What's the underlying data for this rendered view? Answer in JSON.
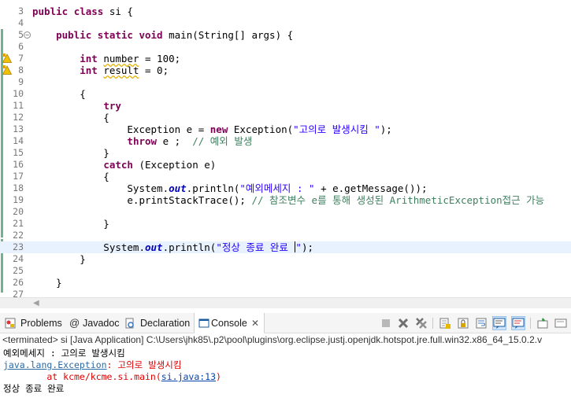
{
  "editor": {
    "lines": [
      {
        "n": "3",
        "tokens": [
          {
            "t": "public",
            "c": "kw"
          },
          {
            "t": " "
          },
          {
            "t": "class",
            "c": "kw"
          },
          {
            "t": " si {"
          }
        ]
      },
      {
        "n": "4",
        "tokens": []
      },
      {
        "n": "5",
        "tokens": [
          {
            "t": "    "
          },
          {
            "t": "public",
            "c": "kw"
          },
          {
            "t": " "
          },
          {
            "t": "static",
            "c": "kw"
          },
          {
            "t": " "
          },
          {
            "t": "void",
            "c": "kw"
          },
          {
            "t": " main(String[] args) {"
          }
        ]
      },
      {
        "n": "6",
        "tokens": []
      },
      {
        "n": "7",
        "tokens": [
          {
            "t": "        "
          },
          {
            "t": "int",
            "c": "kw"
          },
          {
            "t": " "
          },
          {
            "t": "number",
            "c": "warn-var"
          },
          {
            "t": " = 100;"
          }
        ]
      },
      {
        "n": "8",
        "tokens": [
          {
            "t": "        "
          },
          {
            "t": "int",
            "c": "kw"
          },
          {
            "t": " "
          },
          {
            "t": "result",
            "c": "warn-var"
          },
          {
            "t": " = 0;"
          }
        ]
      },
      {
        "n": "9",
        "tokens": []
      },
      {
        "n": "10",
        "tokens": [
          {
            "t": "        {"
          }
        ]
      },
      {
        "n": "11",
        "tokens": [
          {
            "t": "            "
          },
          {
            "t": "try",
            "c": "kw"
          }
        ]
      },
      {
        "n": "12",
        "tokens": [
          {
            "t": "            {"
          }
        ]
      },
      {
        "n": "13",
        "tokens": [
          {
            "t": "                Exception e = "
          },
          {
            "t": "new",
            "c": "kw"
          },
          {
            "t": " Exception("
          },
          {
            "t": "\"고의로 발생시킴 \"",
            "c": "str"
          },
          {
            "t": ");"
          }
        ]
      },
      {
        "n": "14",
        "tokens": [
          {
            "t": "                "
          },
          {
            "t": "throw",
            "c": "kw"
          },
          {
            "t": " e ;  "
          },
          {
            "t": "// 예외 발생",
            "c": "cmt"
          }
        ]
      },
      {
        "n": "15",
        "tokens": [
          {
            "t": "            }"
          }
        ]
      },
      {
        "n": "16",
        "tokens": [
          {
            "t": "            "
          },
          {
            "t": "catch",
            "c": "kw"
          },
          {
            "t": " (Exception e)"
          }
        ]
      },
      {
        "n": "17",
        "tokens": [
          {
            "t": "            {"
          }
        ]
      },
      {
        "n": "18",
        "tokens": [
          {
            "t": "                System."
          },
          {
            "t": "out",
            "c": "ital"
          },
          {
            "t": ".println("
          },
          {
            "t": "\"예외메세지 : \"",
            "c": "str"
          },
          {
            "t": " + e.getMessage());"
          }
        ]
      },
      {
        "n": "19",
        "tokens": [
          {
            "t": "                e.printStackTrace(); "
          },
          {
            "t": "// 참조변수 e를 통해 생성된 ArithmeticException접근 가능",
            "c": "cmt"
          }
        ]
      },
      {
        "n": "20",
        "tokens": []
      },
      {
        "n": "21",
        "tokens": [
          {
            "t": "            }"
          }
        ]
      },
      {
        "n": "22",
        "tokens": []
      },
      {
        "n": "23",
        "tokens": [
          {
            "t": "            System."
          },
          {
            "t": "out",
            "c": "ital"
          },
          {
            "t": ".println("
          },
          {
            "t": "\"정상 종료 완료 ",
            "c": "str"
          },
          {
            "caret": true
          },
          {
            "t": "\"",
            "c": "str"
          },
          {
            "t": ");"
          }
        ],
        "current": true
      },
      {
        "n": "24",
        "tokens": [
          {
            "t": "        }"
          }
        ]
      },
      {
        "n": "25",
        "tokens": []
      },
      {
        "n": "26",
        "tokens": [
          {
            "t": "    }"
          }
        ]
      },
      {
        "n": "27",
        "tokens": []
      }
    ]
  },
  "tabs": [
    {
      "label": "Problems",
      "icon": "problems-icon"
    },
    {
      "label": "Javadoc",
      "icon": "javadoc-icon"
    },
    {
      "label": "Declaration",
      "icon": "declaration-icon"
    },
    {
      "label": "Console",
      "icon": "console-icon",
      "active": true
    }
  ],
  "console": {
    "process_label": "<terminated> si [Java Application] C:\\Users\\jhk85\\.p2\\pool\\plugins\\org.eclipse.justj.openjdk.hotspot.jre.full.win32.x86_64_15.0.2.v",
    "line1": "예외메세지 : 고의로 발생시킴",
    "exception_class": "java.lang.Exception",
    "exception_msg": ": 고의로 발생시킴",
    "at_prefix": "        at kcme/kcme.si.main(",
    "at_link": "si.java:13",
    "at_suffix": ")",
    "line4": "정상 종료 완료"
  },
  "colors": {
    "keyword": "#7f0055",
    "string": "#2a00ff",
    "comment": "#3f7f5f",
    "field": "#0000c0",
    "error_text": "#e00000",
    "current_line": "#e8f2fe"
  }
}
